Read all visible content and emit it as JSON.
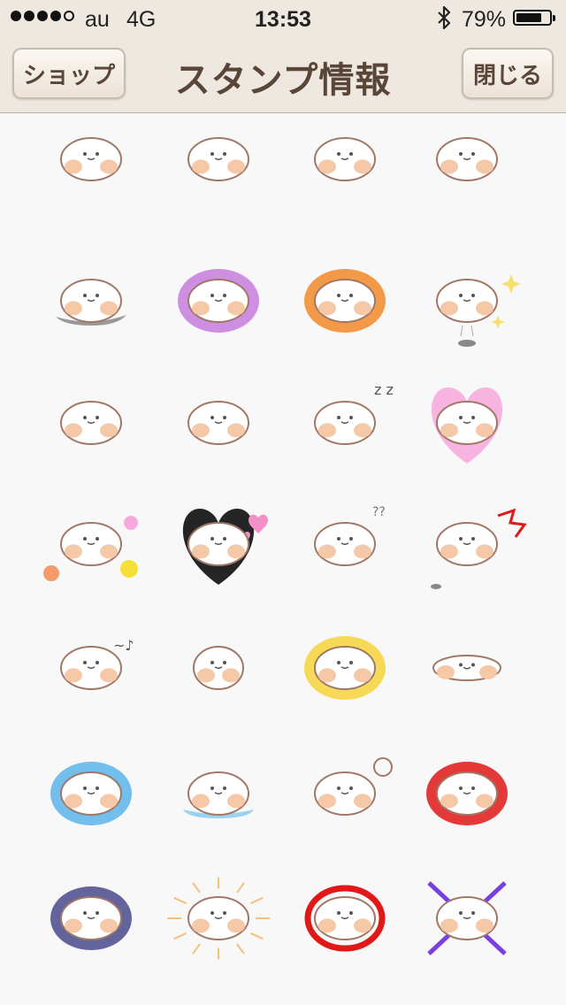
{
  "status_bar": {
    "signal_dots_filled": 4,
    "signal_dots_total": 5,
    "carrier": "au",
    "network": "4G",
    "time": "13:53",
    "battery_percent": "79%",
    "battery_level": 0.79,
    "bluetooth_icon": "bluetooth-icon"
  },
  "nav": {
    "left_button": "ショップ",
    "title": "スタンプ情報",
    "right_button": "閉じる"
  },
  "colors": {
    "bar_bg": "#efe8e0",
    "title_text": "#5a4638",
    "outline": "#a07868",
    "cheek": "#f5c9a8"
  },
  "stickers": [
    {
      "name": "bean-smile",
      "aura": ""
    },
    {
      "name": "bean-dot-eyes",
      "aura": ""
    },
    {
      "name": "bean-grin",
      "aura": ""
    },
    {
      "name": "bean-sleepy-eyes",
      "aura": ""
    },
    {
      "name": "bean-on-gray-stone",
      "aura": ""
    },
    {
      "name": "bean-shocked-purple",
      "aura": "#c77ddf"
    },
    {
      "name": "bean-happy-orange",
      "aura": "#f28a2a"
    },
    {
      "name": "bean-jumping-sparkle",
      "aura": ""
    },
    {
      "name": "bean-rolling-pair",
      "aura": ""
    },
    {
      "name": "bean-peeking-wall",
      "aura": ""
    },
    {
      "name": "bean-sleeping-zzz",
      "aura": ""
    },
    {
      "name": "bean-pink-heart",
      "aura": "#f7a8dc"
    },
    {
      "name": "bean-flowers",
      "aura": ""
    },
    {
      "name": "bean-love-hearts",
      "aura": ""
    },
    {
      "name": "bean-confused",
      "aura": ""
    },
    {
      "name": "bean-surprised-red",
      "aura": ""
    },
    {
      "name": "bean-humming",
      "aura": ""
    },
    {
      "name": "bean-round-small",
      "aura": ""
    },
    {
      "name": "bean-yellow-glow",
      "aura": "#f6d43a"
    },
    {
      "name": "bean-flat-lying",
      "aura": ""
    },
    {
      "name": "bean-blue-sweat",
      "aura": "#5ab4ea"
    },
    {
      "name": "bean-crying-puddle",
      "aura": ""
    },
    {
      "name": "bean-thinking-bubble",
      "aura": ""
    },
    {
      "name": "bean-red-angry",
      "aura": "#e01818"
    },
    {
      "name": "bean-navy-gloomy",
      "aura": "#4a4a8c"
    },
    {
      "name": "bean-sunshine",
      "aura": ""
    },
    {
      "name": "bean-red-ring",
      "aura": "#e01818"
    },
    {
      "name": "bean-purple-cross",
      "aura": ""
    }
  ]
}
